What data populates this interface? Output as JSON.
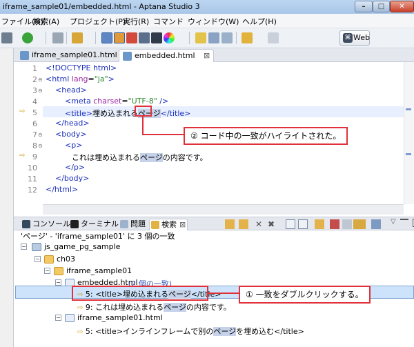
{
  "window": {
    "title": "iframe_sample01/embedded.html - Aptana Studio 3",
    "minimize": "–",
    "maximize": "□",
    "close": "✕"
  },
  "menu": [
    "ファイル(N)",
    "検索(A)",
    "プロジェクト(P)",
    "実行(R)",
    "コマンド",
    "ウィンドウ(W)",
    "ヘルプ(H)"
  ],
  "toolbar": {
    "web_label": "Web"
  },
  "editor_tabs": [
    {
      "label": "iframe_sample01.html",
      "active": false
    },
    {
      "label": "embedded.html",
      "active": true,
      "close": "⊠"
    }
  ],
  "editor": {
    "line_numbers": [
      "1",
      "2",
      "3",
      "4",
      "5",
      "6",
      "7",
      "8",
      "9",
      "10",
      "11",
      "12"
    ],
    "lines": {
      "l1": "<!DOCTYPE html>",
      "l2_open": "<html",
      "l2_attr": " lang",
      "l2_eq": "=",
      "l2_val": "\"ja\"",
      "l2_close": ">",
      "l3": "<head>",
      "l4_open": "<meta",
      "l4_attr": " charset",
      "l4_eq": "=",
      "l4_val": "\"UTF-8\"",
      "l4_close": " />",
      "l5_open": "<title>",
      "l5_text": "埋め込まれる",
      "l5_match": "ページ",
      "l5_close": "</title>",
      "l6": "</head>",
      "l7": "<body>",
      "l8": "<p>",
      "l9_text": "これは埋め込まれる",
      "l9_match": "ページ",
      "l9_rest": "の内容です。",
      "l10": "</p>",
      "l11": "</body>",
      "l12": "</html>"
    }
  },
  "bottom_tabs": [
    {
      "label": "コンソール"
    },
    {
      "label": "ターミナル"
    },
    {
      "label": "問題"
    },
    {
      "label": "検索",
      "active": true,
      "close": "⊠"
    }
  ],
  "search": {
    "summary": "'ページ' - 'iframe_sample01' に 3 個の一致",
    "project": "js_game_pg_sample",
    "folder1": "ch03",
    "folder2": "iframe_sample01",
    "file1": "embedded.html",
    "file1_count": "(2 個の一致)",
    "match1_prefix": "5: <title>埋め込まれる",
    "match1_hl": "ページ",
    "match1_suffix": "</title>",
    "match2_prefix": "9: これは埋め込まれる",
    "match2_hl": "ページ",
    "match2_suffix": "の内容です。",
    "file2": "iframe_sample01.html",
    "match3_prefix": "5: <title>インラインフレームで別の",
    "match3_hl": "ページ",
    "match3_suffix": "を埋め込む</title>",
    "expand_minus": "−"
  },
  "annotations": {
    "callout_top": "② コード中の一致がハイライトされた。",
    "callout_bottom": "① 一致をダブルクリックする。"
  }
}
